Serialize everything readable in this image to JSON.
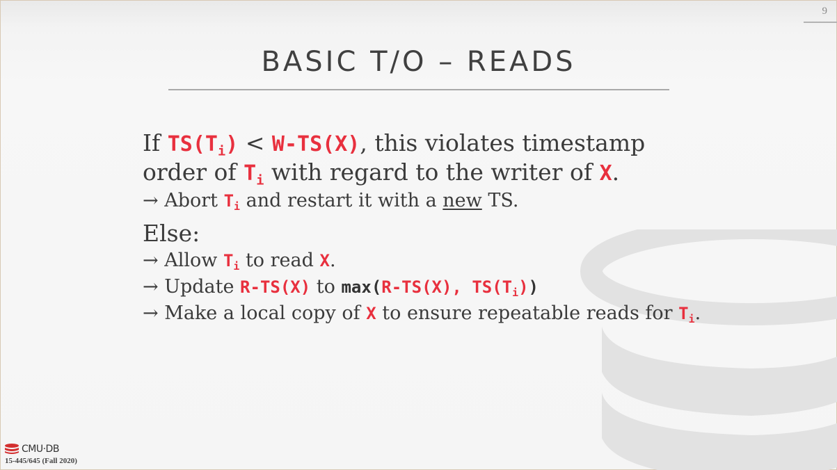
{
  "page_number": "9",
  "title": "BASIC T/O – READS",
  "body": {
    "line1": {
      "p1": "If ",
      "c1": "TS(T",
      "c1_sub": "i",
      "c1_end": ")",
      "p2": " < ",
      "c2": "W-TS(X)",
      "p3": ", this violates timestamp"
    },
    "line2": {
      "p1": "order of ",
      "c1": "T",
      "c1_sub": "i",
      "p2": " with regard to the writer of ",
      "c2": "X",
      "p3": "."
    },
    "line3": {
      "arrow": "→",
      "p1": " Abort ",
      "c1": "T",
      "c1_sub": "i",
      "p2": " and restart it with a ",
      "u": "new",
      "p3": " TS."
    },
    "line4": {
      "p1": "Else:"
    },
    "line5": {
      "arrow": "→",
      "p1": " Allow ",
      "c1": "T",
      "c1_sub": "i",
      "p2": " to read ",
      "c2": "X",
      "p3": "."
    },
    "line6": {
      "arrow": "→",
      "p1": " Update ",
      "c1": "R-TS(X)",
      "p2": " to ",
      "c_max": "max(",
      "c2": "R-TS(X), TS(T",
      "c2_sub": "i",
      "c2_end": ")",
      "c_close": ")"
    },
    "line7": {
      "arrow": "→",
      "p1": " Make a local copy of ",
      "c1": "X",
      "p2": " to ensure repeatable reads for ",
      "c2": "T",
      "c2_sub": "i",
      "p3": "."
    }
  },
  "footer": {
    "logo_text": "CMU·DB",
    "course": "15-445/645 (Fall 2020)"
  },
  "colors": {
    "accent": "#e8303e",
    "text": "#3b3b3b"
  }
}
